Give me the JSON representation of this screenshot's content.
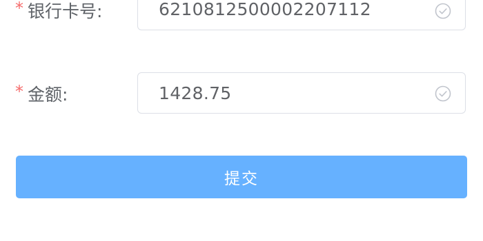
{
  "form": {
    "card_field": {
      "required_mark": "*",
      "label": "银行卡号:",
      "value": "6210812500002207112",
      "status_icon": "check-circle-icon"
    },
    "amount_field": {
      "required_mark": "*",
      "label": "金额:",
      "value": "1428.75",
      "status_icon": "check-circle-icon"
    },
    "submit_label": "提交"
  },
  "colors": {
    "required": "#f56c6c",
    "button": "#66b1ff",
    "border": "#dcdfe6",
    "icon": "#c0c4cc"
  }
}
